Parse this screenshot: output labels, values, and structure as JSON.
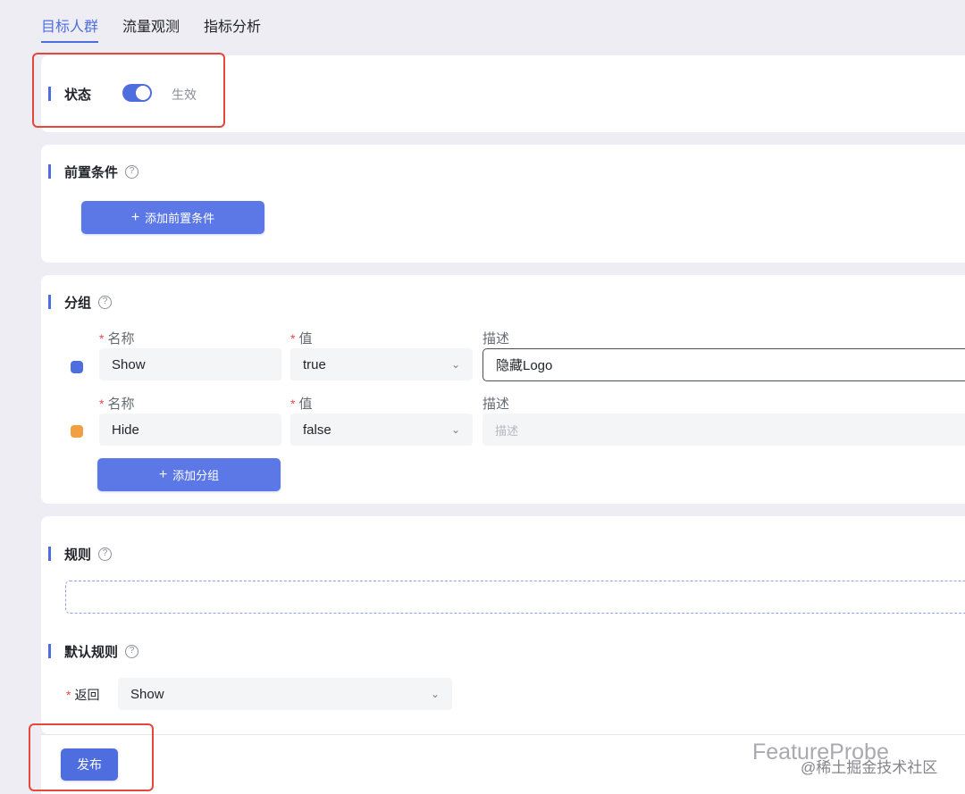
{
  "tabs": [
    {
      "label": "目标人群",
      "active": true
    },
    {
      "label": "流量观测",
      "active": false
    },
    {
      "label": "指标分析",
      "active": false
    }
  ],
  "status_section": {
    "title": "状态",
    "toggle_on": true,
    "status_text": "生效"
  },
  "precondition_section": {
    "title": "前置条件",
    "add_button": "添加前置条件"
  },
  "group_section": {
    "title": "分组",
    "labels": {
      "name": "名称",
      "value": "值",
      "description": "描述"
    },
    "rows": [
      {
        "color": "#4e6ee0",
        "name": "Show",
        "value": "true",
        "description": "隐藏Logo",
        "description_placeholder": ""
      },
      {
        "color": "#f0a042",
        "name": "Hide",
        "value": "false",
        "description": "",
        "description_placeholder": "描述"
      }
    ],
    "add_button": "添加分组"
  },
  "rules_section": {
    "title": "规则"
  },
  "default_rule_section": {
    "title": "默认规则",
    "return_label": "返回",
    "return_value": "Show"
  },
  "publish_button": "发布",
  "watermark": {
    "text": "FeatureProbe",
    "sub": "@稀土掘金技术社区"
  },
  "colors": {
    "accent": "#4e6ee0",
    "button": "#5b78e6",
    "highlight": "#e5483a"
  },
  "icons": {
    "help": "?",
    "plus": "+",
    "chevron": "⌄"
  }
}
